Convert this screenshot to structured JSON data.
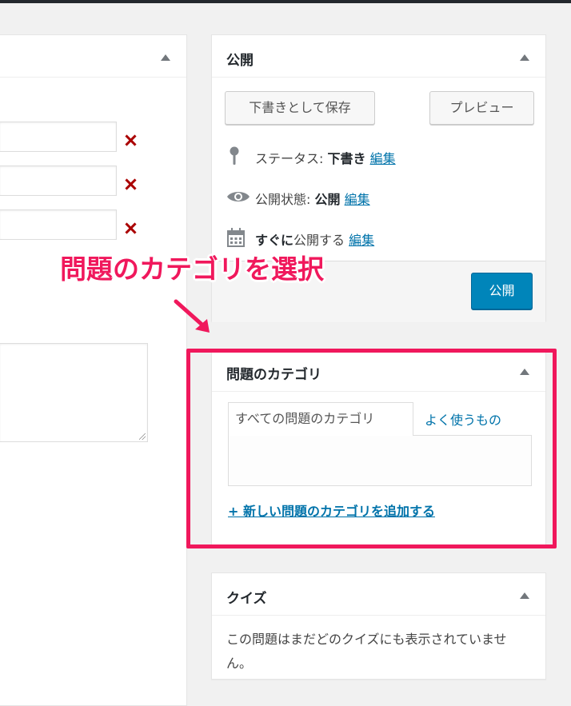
{
  "left_panel": {
    "remove_icon": "close-icon"
  },
  "publish": {
    "title": "公開",
    "save_draft_label": "下書きとして保存",
    "preview_label": "プレビュー",
    "status_label": "ステータス:",
    "status_value": "下書き",
    "status_edit": "編集",
    "visibility_label": "公開状態:",
    "visibility_value": "公開",
    "visibility_edit": "編集",
    "schedule_value": "すぐに",
    "schedule_label": "公開する",
    "schedule_edit": "編集",
    "publish_button": "公開"
  },
  "annotation": {
    "text": "問題のカテゴリを選択"
  },
  "category": {
    "title": "問題のカテゴリ",
    "tab_all": "すべての問題のカテゴリ",
    "tab_popular": "よく使うもの",
    "add_new": "+ 新しい問題のカテゴリを追加する"
  },
  "quiz": {
    "title": "クイズ",
    "text": "この問題はまだどのクイズにも表示されていません。"
  },
  "colors": {
    "accent": "#f0185c",
    "primary_button": "#0085ba",
    "link": "#0073aa"
  }
}
